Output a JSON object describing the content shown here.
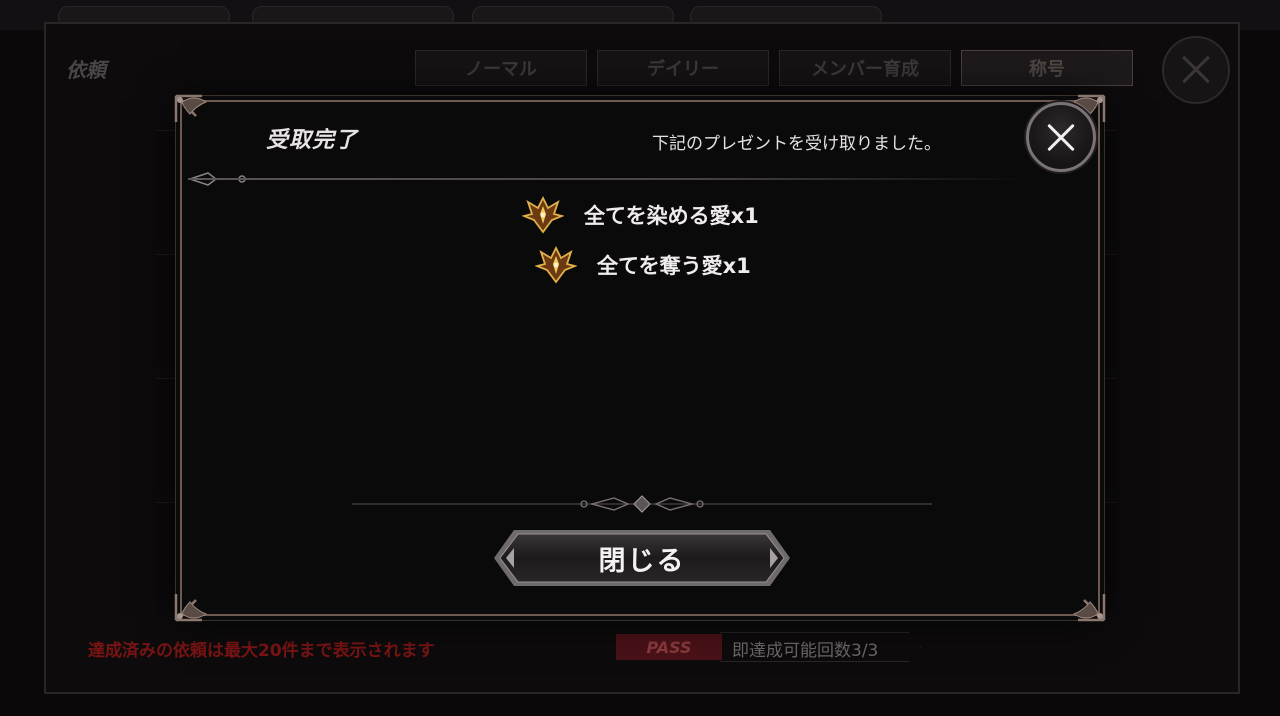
{
  "background": {
    "title": "依頼",
    "tabs": [
      "ノーマル",
      "デイリー",
      "メンバー育成",
      "称号"
    ],
    "active_tab": "称号",
    "notice": "達成済みの依頼は最大20件まで表示されます",
    "pass_badge": "PASS",
    "pass_text": "即達成可能回数3/3"
  },
  "modal": {
    "title": "受取完了",
    "message": "下記のプレゼントを受け取りました。",
    "rewards": [
      {
        "label": "全てを染める愛x1",
        "icon": "crest-icon"
      },
      {
        "label": "全てを奪う愛x1",
        "icon": "crest-icon"
      }
    ],
    "close_button_label": "閉じる"
  },
  "colors": {
    "frame": "#6e5a52",
    "notice_red": "#7a1414",
    "pass_red": "#4a1218",
    "crest_gold": "#d9a441"
  }
}
